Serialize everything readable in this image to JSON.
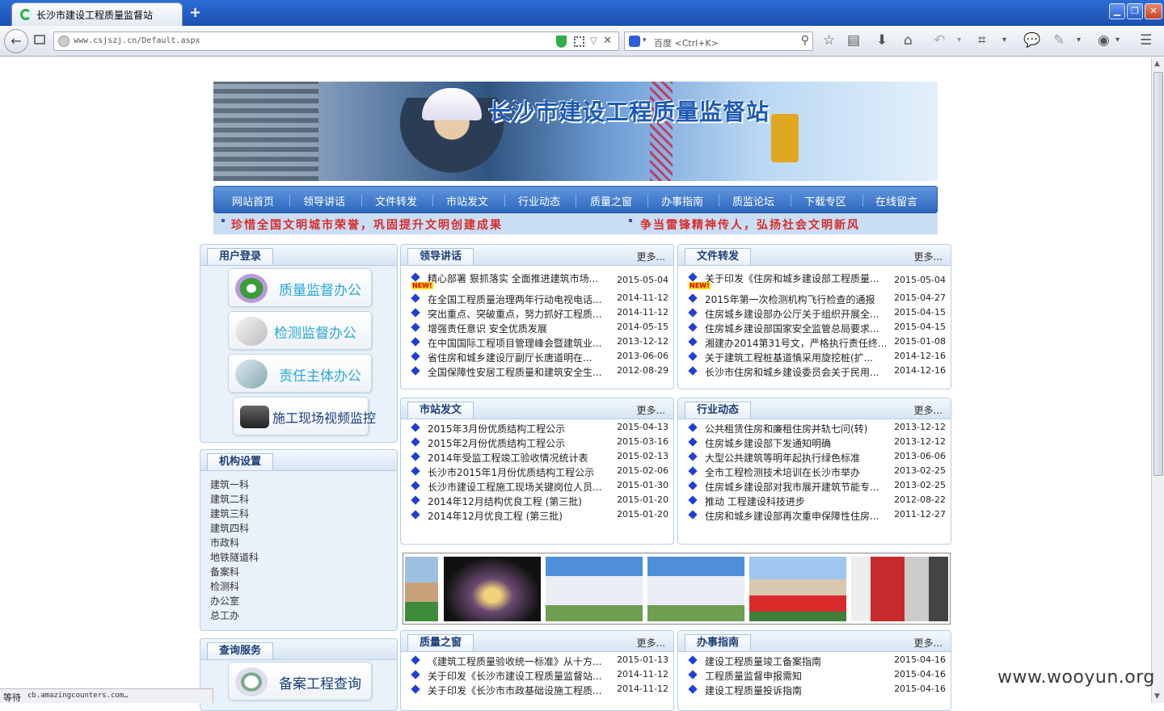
{
  "browser": {
    "tab_title": "长沙市建设工程质量监督站",
    "url": "www.csjszj.cn/Default.aspx",
    "search_placeholder": "百度 <Ctrl+K>",
    "status_left": "等待",
    "status_url": "cb.amazingcounters.com…"
  },
  "site": {
    "banner_title": "长沙市建设工程质量监督站",
    "menu": [
      "网站首页",
      "领导讲话",
      "文件转发",
      "市站发文",
      "行业动态",
      "质量之窗",
      "办事指南",
      "质监论坛",
      "下载专区",
      "在线留言"
    ],
    "slogans": [
      "珍惜全国文明城市荣誉，巩固提升文明创建成果",
      "争当雷锋精神传人，弘扬社会文明新风"
    ]
  },
  "sidebar": {
    "login": {
      "title": "用户登录",
      "buttons": [
        "质量监督办公",
        "检测监督办公",
        "责任主体办公",
        "施工现场视频监控"
      ]
    },
    "org": {
      "title": "机构设置",
      "items": [
        "建筑一科",
        "建筑二科",
        "建筑三科",
        "建筑四科",
        "市政科",
        "地铁隧道科",
        "备案科",
        "检测科",
        "办公室",
        "总工办"
      ]
    },
    "query": {
      "title": "查询服务",
      "button": "备案工程查询"
    }
  },
  "panels": {
    "leader": {
      "title": "领导讲话",
      "more": "更多...",
      "items": [
        {
          "text": "精心部署 狠抓落实 全面推进建筑市场...",
          "date": "2015-05-04"
        },
        {
          "text": "在全国工程质量治理两年行动电视电话...",
          "date": "2014-11-12"
        },
        {
          "text": "突出重点、突破重点，努力抓好工程质...",
          "date": "2014-11-12"
        },
        {
          "text": "增强责任意识 安全优质发展",
          "date": "2014-05-15"
        },
        {
          "text": "在中国国际工程项目管理峰会暨建筑业...",
          "date": "2013-12-12"
        },
        {
          "text": "省住房和城乡建设厅副厅长唐道明在...",
          "date": "2013-06-06"
        },
        {
          "text": "全国保障性安居工程质量和建筑安全生...",
          "date": "2012-08-29"
        }
      ]
    },
    "docs": {
      "title": "文件转发",
      "more": "更多...",
      "items": [
        {
          "text": "关于印发《住房和城乡建设部工程质量...",
          "date": "2015-05-04"
        },
        {
          "text": "2015年第一次检测机构飞行检查的通报",
          "date": "2015-04-27"
        },
        {
          "text": "住房城乡建设部办公厅关于组织开展全...",
          "date": "2015-04-15"
        },
        {
          "text": "住房城乡建设部国家安全监管总局要求...",
          "date": "2015-04-15"
        },
        {
          "text": "湘建办2014第31号文，严格执行责任终...",
          "date": "2015-01-08"
        },
        {
          "text": "关于建筑工程桩基道慎采用旋挖桩(扩...",
          "date": "2014-12-16"
        },
        {
          "text": "长沙市住房和城乡建设委员会关于民用...",
          "date": "2014-12-16"
        }
      ]
    },
    "station": {
      "title": "市站发文",
      "more": "更多...",
      "items": [
        {
          "text": "2015年3月份优质结构工程公示",
          "date": "2015-04-13"
        },
        {
          "text": "2015年2月份优质结构工程公示",
          "date": "2015-03-16"
        },
        {
          "text": "2014年受监工程竣工验收情况统计表",
          "date": "2015-02-13"
        },
        {
          "text": "长沙市2015年1月份优质结构工程公示",
          "date": "2015-02-06"
        },
        {
          "text": "长沙市建设工程施工现场关键岗位人员...",
          "date": "2015-01-30"
        },
        {
          "text": "2014年12月结构优良工程 (第三批)",
          "date": "2015-01-20"
        },
        {
          "text": "2014年12月优良工程 (第三批)",
          "date": "2015-01-20"
        }
      ]
    },
    "industry": {
      "title": "行业动态",
      "more": "更多...",
      "items": [
        {
          "text": "公共租赁住房和廉租住房并轨七问(转)",
          "date": "2013-12-12"
        },
        {
          "text": "住房城乡建设部下发通知明确",
          "date": "2013-12-12"
        },
        {
          "text": "大型公共建筑等明年起执行绿色标准",
          "date": "2013-06-06"
        },
        {
          "text": "全市工程检测技术培训在长沙市举办",
          "date": "2013-02-25"
        },
        {
          "text": "住房城乡建设部对我市展开建筑节能专...",
          "date": "2013-02-25"
        },
        {
          "text": "推动 工程建设科技进步",
          "date": "2012-08-22"
        },
        {
          "text": "住房和城乡建设部再次重申保障性住房...",
          "date": "2011-12-27"
        }
      ]
    },
    "quality": {
      "title": "质量之窗",
      "more": "更多...",
      "items": [
        {
          "text": "《建筑工程质量验收统一标准》从十方...",
          "date": "2015-01-13"
        },
        {
          "text": "关于印发《长沙市建设工程质量监督站...",
          "date": "2014-11-12"
        },
        {
          "text": "关于印发《长沙市市政基础设施工程质...",
          "date": "2014-11-12"
        }
      ]
    },
    "guide": {
      "title": "办事指南",
      "more": "更多...",
      "items": [
        {
          "text": "建设工程质量竣工备案指南",
          "date": "2015-04-16"
        },
        {
          "text": "工程质量监督申报需知",
          "date": "2015-04-16"
        },
        {
          "text": "建设工程质量投诉指南",
          "date": "2015-04-16"
        }
      ]
    }
  },
  "new_badge": "NEW!",
  "watermark": "www.wooyun.org"
}
